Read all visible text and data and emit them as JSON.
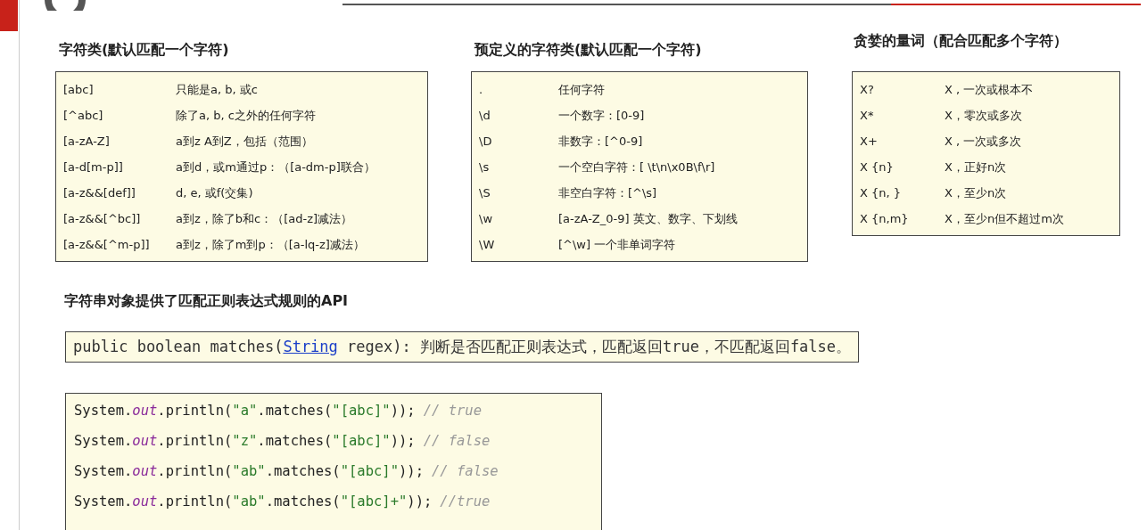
{
  "tables": [
    {
      "title": "字符类(默认匹配一个字符)",
      "rows": [
        {
          "pattern": "[abc]",
          "meaning": "只能是a, b, 或c"
        },
        {
          "pattern": "[^abc]",
          "meaning": "除了a, b, c之外的任何字符"
        },
        {
          "pattern": "[a-zA-Z]",
          "meaning": "a到z A到Z，包括（范围）"
        },
        {
          "pattern": "[a-d[m-p]]",
          "meaning": "a到d，或m通过p：（[a-dm-p]联合）"
        },
        {
          "pattern": "[a-z&&[def]]",
          "meaning": "d, e, 或f(交集)"
        },
        {
          "pattern": "[a-z&&[^bc]]",
          "meaning": "a到z，除了b和c：（[ad-z]减法）"
        },
        {
          "pattern": "[a-z&&[^m-p]]",
          "meaning": "a到z，除了m到p：（[a-lq-z]减法）"
        }
      ]
    },
    {
      "title": "预定义的字符类(默认匹配一个字符)",
      "rows": [
        {
          "pattern": ".",
          "meaning": "任何字符"
        },
        {
          "pattern": "\\d",
          "meaning": "一个数字：[0-9]"
        },
        {
          "pattern": "\\D",
          "meaning": "非数字：[^0-9]"
        },
        {
          "pattern": "\\s",
          "meaning": "一个空白字符：[ \\t\\n\\x0B\\f\\r]"
        },
        {
          "pattern": "\\S",
          "meaning": "非空白字符：[^\\s]"
        },
        {
          "pattern": "\\w",
          "meaning": "[a-zA-Z_0-9] 英文、数字、下划线"
        },
        {
          "pattern": "\\W",
          "meaning": "[^\\w] 一个非单词字符"
        }
      ]
    },
    {
      "title": "贪婪的量词（配合匹配多个字符）",
      "rows": [
        {
          "pattern": "X?",
          "meaning": "X , 一次或根本不"
        },
        {
          "pattern": "X*",
          "meaning": "X，零次或多次"
        },
        {
          "pattern": "X+",
          "meaning": "X , 一次或多次"
        },
        {
          "pattern": "X {n}",
          "meaning": "X，正好n次"
        },
        {
          "pattern": "X {n, }",
          "meaning": "X，至少n次"
        },
        {
          "pattern": "X {n,m}",
          "meaning": "X，至少n但不超过m次"
        }
      ]
    }
  ],
  "api_heading": "字符串对象提供了匹配正则表达式规则的API",
  "api_signature": {
    "before": "public boolean matches(",
    "link": "String",
    "after": " regex): 判断是否匹配正则表达式，匹配返回true，不匹配返回false。"
  },
  "code_lines": [
    [
      {
        "kind": "plain",
        "text": "System."
      },
      {
        "kind": "field",
        "text": "out"
      },
      {
        "kind": "plain",
        "text": ".println("
      },
      {
        "kind": "string",
        "text": "\"a\""
      },
      {
        "kind": "plain",
        "text": ".matches("
      },
      {
        "kind": "string",
        "text": "\"[abc]\""
      },
      {
        "kind": "plain",
        "text": "));"
      },
      {
        "kind": "comment",
        "text": "// true"
      }
    ],
    [
      {
        "kind": "plain",
        "text": "System."
      },
      {
        "kind": "field",
        "text": "out"
      },
      {
        "kind": "plain",
        "text": ".println("
      },
      {
        "kind": "string",
        "text": "\"z\""
      },
      {
        "kind": "plain",
        "text": ".matches("
      },
      {
        "kind": "string",
        "text": "\"[abc]\""
      },
      {
        "kind": "plain",
        "text": "));"
      },
      {
        "kind": "comment",
        "text": "// false"
      }
    ],
    [
      {
        "kind": "plain",
        "text": "System."
      },
      {
        "kind": "field",
        "text": "out"
      },
      {
        "kind": "plain",
        "text": ".println("
      },
      {
        "kind": "string",
        "text": "\"ab\""
      },
      {
        "kind": "plain",
        "text": ".matches("
      },
      {
        "kind": "string",
        "text": "\"[abc]\""
      },
      {
        "kind": "plain",
        "text": "));"
      },
      {
        "kind": "comment",
        "text": "// false"
      }
    ],
    [
      {
        "kind": "plain",
        "text": "System."
      },
      {
        "kind": "field",
        "text": "out"
      },
      {
        "kind": "plain",
        "text": ".println("
      },
      {
        "kind": "string",
        "text": "\"ab\""
      },
      {
        "kind": "plain",
        "text": ".matches("
      },
      {
        "kind": "string",
        "text": "\"[abc]+\""
      },
      {
        "kind": "plain",
        "text": "));"
      },
      {
        "kind": "comment",
        "text": "//true"
      }
    ]
  ]
}
